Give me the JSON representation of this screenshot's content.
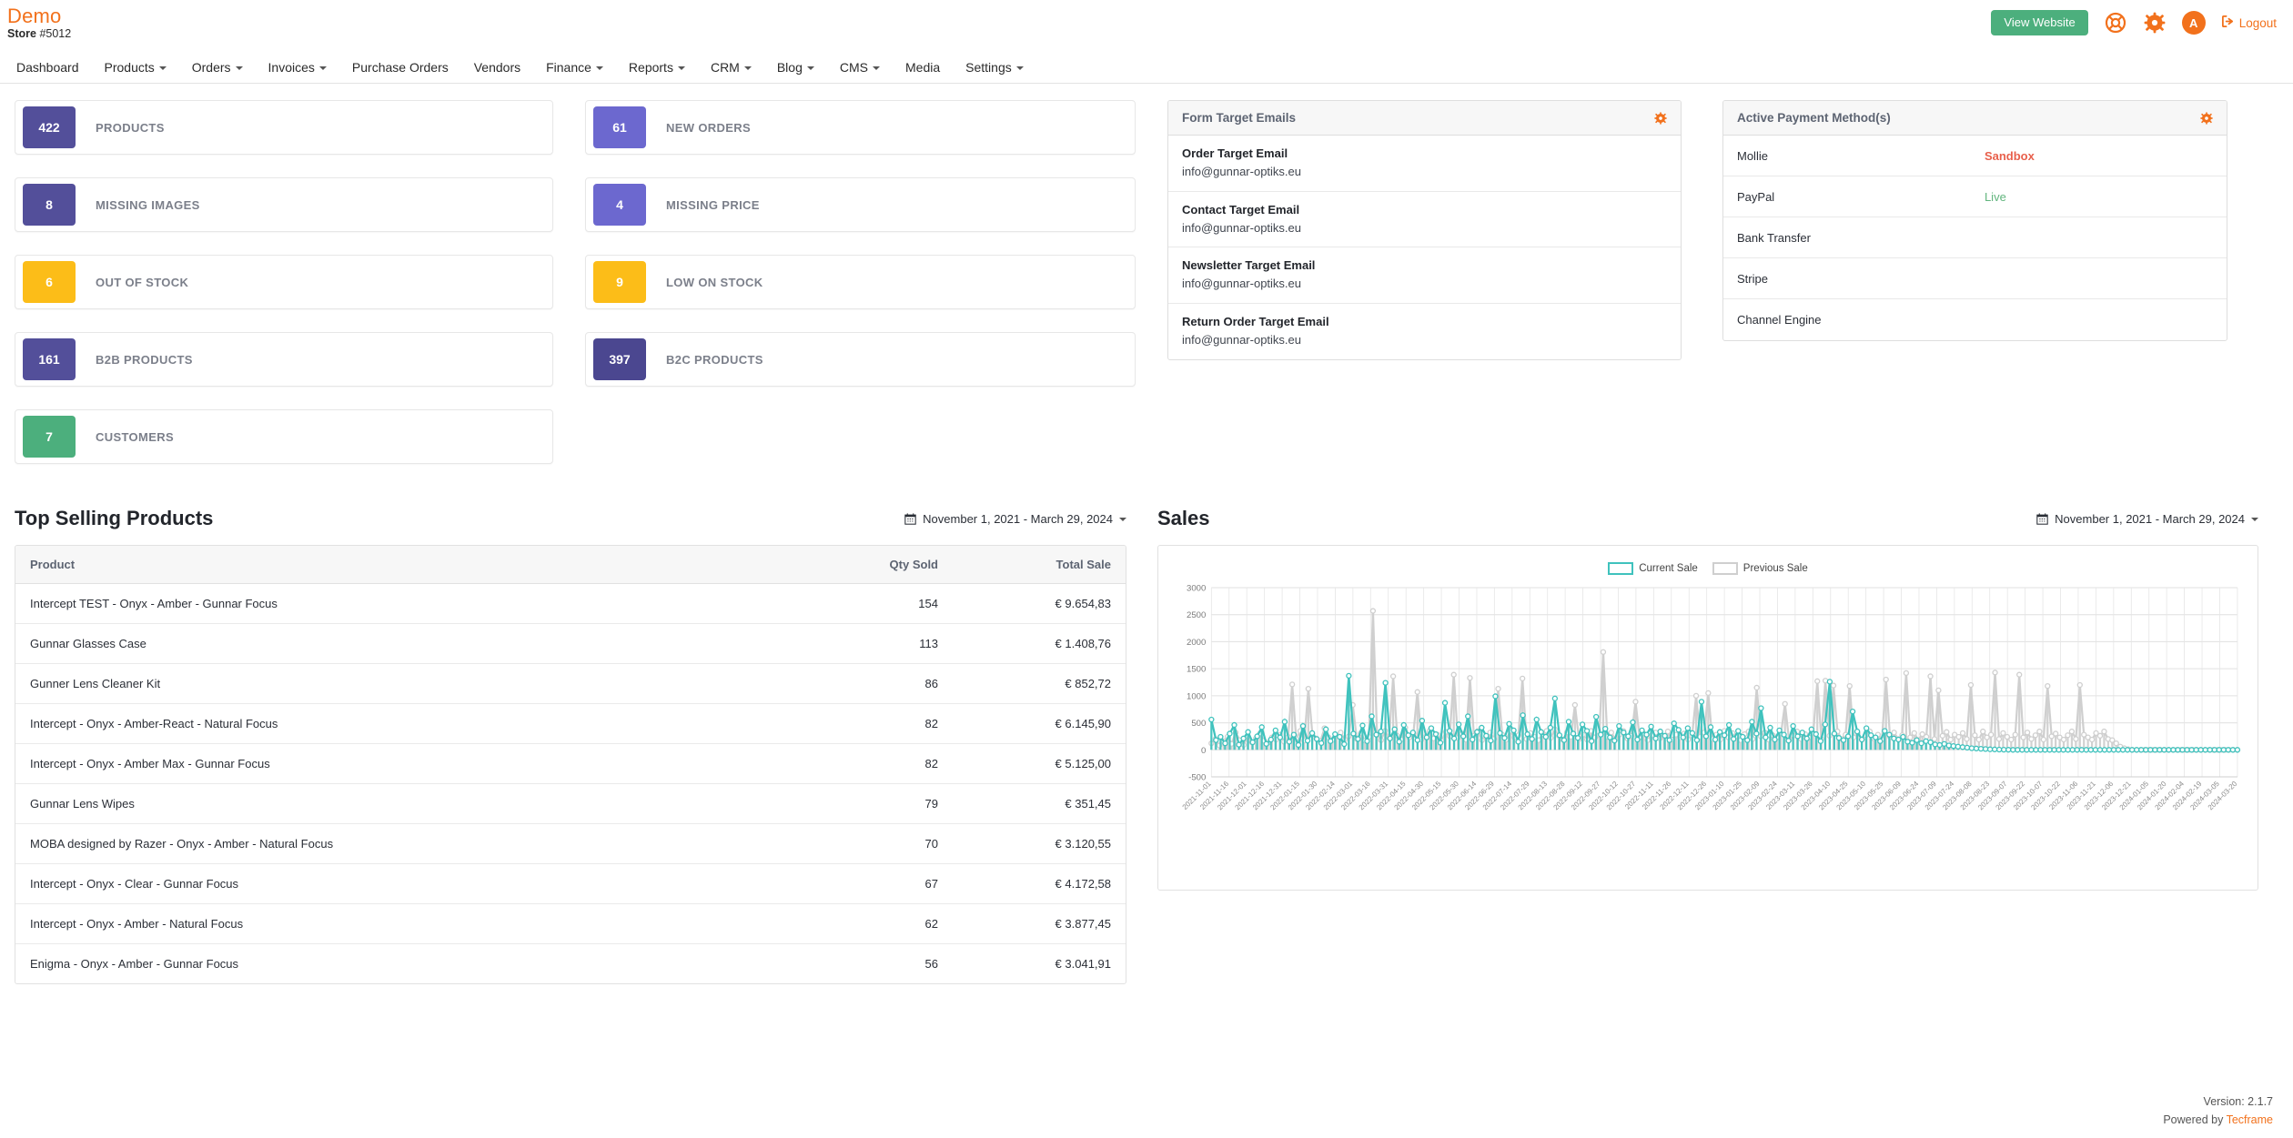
{
  "header": {
    "brand": "Demo",
    "store_label": "Store",
    "store_number": "#5012",
    "view_website_label": "View Website",
    "logout_label": "Logout",
    "avatar_initial": "A",
    "icons": [
      "lifebuoy-icon",
      "gear-icon",
      "avatar",
      "logout-icon"
    ],
    "accent_color": "#f2711c",
    "button_color": "#4caf7d"
  },
  "nav": {
    "items": [
      {
        "label": "Dashboard",
        "has_caret": false
      },
      {
        "label": "Products",
        "has_caret": true
      },
      {
        "label": "Orders",
        "has_caret": true
      },
      {
        "label": "Invoices",
        "has_caret": true
      },
      {
        "label": "Purchase Orders",
        "has_caret": false
      },
      {
        "label": "Vendors",
        "has_caret": false
      },
      {
        "label": "Finance",
        "has_caret": true
      },
      {
        "label": "Reports",
        "has_caret": true
      },
      {
        "label": "CRM",
        "has_caret": true
      },
      {
        "label": "Blog",
        "has_caret": true
      },
      {
        "label": "CMS",
        "has_caret": true
      },
      {
        "label": "Media",
        "has_caret": false
      },
      {
        "label": "Settings",
        "has_caret": true
      }
    ]
  },
  "stats_col_a": [
    {
      "value": "422",
      "label": "PRODUCTS",
      "color": "#534f9a"
    },
    {
      "value": "8",
      "label": "MISSING IMAGES",
      "color": "#534f9a"
    },
    {
      "value": "6",
      "label": "OUT OF STOCK",
      "color": "#fcbd18"
    },
    {
      "value": "161",
      "label": "B2B PRODUCTS",
      "color": "#534f9a"
    },
    {
      "value": "7",
      "label": "CUSTOMERS",
      "color": "#4caf7d"
    }
  ],
  "stats_col_b": [
    {
      "value": "61",
      "label": "NEW ORDERS",
      "color": "#6c68cf"
    },
    {
      "value": "4",
      "label": "MISSING PRICE",
      "color": "#6c68cf"
    },
    {
      "value": "9",
      "label": "LOW ON STOCK",
      "color": "#fcbd18"
    },
    {
      "value": "397",
      "label": "B2C PRODUCTS",
      "color": "#4b4790"
    }
  ],
  "form_emails_panel": {
    "title": "Form Target Emails",
    "gear_icon": "gear-icon",
    "rows": [
      {
        "label": "Order Target Email",
        "value": "info@gunnar-optiks.eu"
      },
      {
        "label": "Contact Target Email",
        "value": "info@gunnar-optiks.eu"
      },
      {
        "label": "Newsletter Target Email",
        "value": "info@gunnar-optiks.eu"
      },
      {
        "label": "Return Order Target Email",
        "value": "info@gunnar-optiks.eu"
      }
    ]
  },
  "payment_panel": {
    "title": "Active Payment Method(s)",
    "gear_icon": "gear-icon",
    "rows": [
      {
        "name": "Mollie",
        "status": "Sandbox",
        "status_type": "sandbox"
      },
      {
        "name": "PayPal",
        "status": "Live",
        "status_type": "live"
      },
      {
        "name": "Bank Transfer",
        "status": "",
        "status_type": "none"
      },
      {
        "name": "Stripe",
        "status": "",
        "status_type": "none"
      },
      {
        "name": "Channel Engine",
        "status": "",
        "status_type": "none"
      }
    ]
  },
  "top_selling": {
    "title": "Top Selling Products",
    "date_range": "November 1, 2021 - March 29, 2024",
    "columns": [
      "Product",
      "Qty Sold",
      "Total Sale"
    ],
    "rows": [
      {
        "product": "Intercept TEST - Onyx - Amber - Gunnar Focus",
        "qty": "154",
        "total": "€ 9.654,83"
      },
      {
        "product": "Gunnar Glasses Case",
        "qty": "113",
        "total": "€ 1.408,76"
      },
      {
        "product": "Gunner Lens Cleaner Kit",
        "qty": "86",
        "total": "€ 852,72"
      },
      {
        "product": "Intercept - Onyx - Amber-React - Natural Focus",
        "qty": "82",
        "total": "€ 6.145,90"
      },
      {
        "product": "Intercept - Onyx - Amber Max - Gunnar Focus",
        "qty": "82",
        "total": "€ 5.125,00"
      },
      {
        "product": "Gunnar Lens Wipes",
        "qty": "79",
        "total": "€ 351,45"
      },
      {
        "product": "MOBA designed by Razer - Onyx - Amber - Natural Focus",
        "qty": "70",
        "total": "€ 3.120,55"
      },
      {
        "product": "Intercept - Onyx - Clear - Gunnar Focus",
        "qty": "67",
        "total": "€ 4.172,58"
      },
      {
        "product": "Intercept - Onyx - Amber - Natural Focus",
        "qty": "62",
        "total": "€ 3.877,45"
      },
      {
        "product": "Enigma - Onyx - Amber - Gunnar Focus",
        "qty": "56",
        "total": "€ 3.041,91"
      }
    ]
  },
  "sales": {
    "title": "Sales",
    "date_range": "November 1, 2021 - March 29, 2024"
  },
  "footer": {
    "version": "Version: 2.1.7",
    "powered_prefix": "Powered by ",
    "powered_by": "Tecframe"
  },
  "chart_data": {
    "type": "line",
    "title": "Sales",
    "xlabel": "",
    "ylabel": "",
    "ylim": [
      -500,
      3000
    ],
    "yticks": [
      3000,
      2500,
      2000,
      1500,
      1000,
      500,
      0,
      -500
    ],
    "grid": true,
    "legend_position": "top-center",
    "date_range": "November 1, 2021 - March 29, 2024",
    "x_tick_labels": [
      "2021-11-01",
      "2021-11-16",
      "2021-12-01",
      "2021-12-16",
      "2021-12-31",
      "2022-01-15",
      "2022-01-30",
      "2022-02-14",
      "2022-03-01",
      "2022-03-16",
      "2022-03-31",
      "2022-04-15",
      "2022-04-30",
      "2022-05-15",
      "2022-05-30",
      "2022-06-14",
      "2022-06-29",
      "2022-07-14",
      "2022-07-29",
      "2022-08-13",
      "2022-08-28",
      "2022-09-12",
      "2022-09-27",
      "2022-10-12",
      "2022-10-27",
      "2022-11-11",
      "2022-11-26",
      "2022-12-11",
      "2022-12-26",
      "2023-01-10",
      "2023-01-25",
      "2023-02-09",
      "2023-02-24",
      "2023-03-11",
      "2023-03-26",
      "2023-04-10",
      "2023-04-25",
      "2023-05-10",
      "2023-05-25",
      "2023-06-09",
      "2023-06-24",
      "2023-07-09",
      "2023-07-24",
      "2023-08-08",
      "2023-08-23",
      "2023-09-07",
      "2023-09-22",
      "2023-10-07",
      "2023-10-22",
      "2023-11-06",
      "2023-11-21",
      "2023-12-06",
      "2023-12-21",
      "2024-01-05",
      "2024-01-20",
      "2024-02-04",
      "2024-02-19",
      "2024-03-05",
      "2024-03-20"
    ],
    "series": [
      {
        "name": "Current Sale",
        "color": "#3fc2bd",
        "note": "Dense daily spiky series, active Nov 2021 - mid 2022, then flat at 0",
        "values": [
          560,
          180,
          240,
          120,
          300,
          460,
          95,
          210,
          330,
          140,
          250,
          420,
          110,
          190,
          360,
          230,
          520,
          150,
          280,
          90,
          440,
          170,
          310,
          200,
          125,
          380,
          160,
          290,
          240,
          105,
          1370,
          300,
          200,
          450,
          160,
          620,
          280,
          340,
          1240,
          210,
          380,
          150,
          460,
          270,
          320,
          180,
          540,
          230,
          400,
          290,
          130,
          870,
          350,
          210,
          470,
          250,
          620,
          190,
          330,
          410,
          260,
          170,
          990,
          310,
          220,
          480,
          360,
          150,
          640,
          290,
          200,
          560,
          330,
          240,
          410,
          950,
          270,
          180,
          520,
          300,
          220,
          470,
          350,
          160,
          610,
          280,
          390,
          230,
          170,
          440,
          320,
          250,
          510,
          190,
          360,
          280,
          430,
          210,
          340,
          260,
          180,
          490,
          370,
          230,
          400,
          310,
          180,
          890,
          250,
          420,
          190,
          330,
          270,
          460,
          200,
          350,
          240,
          180,
          520,
          300,
          770,
          230,
          410,
          190,
          360,
          280,
          170,
          440,
          250,
          320,
          210,
          380,
          290,
          160,
          470,
          1260,
          300,
          220,
          180,
          250,
          710,
          340,
          190,
          400,
          270,
          230,
          160,
          350,
          280,
          210,
          190,
          240,
          150,
          130,
          180,
          120,
          160,
          140,
          100,
          90,
          110,
          80,
          70,
          60,
          50,
          40,
          30,
          25,
          20,
          15,
          10,
          8,
          5,
          3,
          2,
          0,
          0,
          0,
          0,
          0,
          0,
          0,
          0,
          0,
          0,
          0,
          0,
          0,
          0,
          0,
          0,
          0,
          0,
          0,
          0,
          0,
          0,
          0,
          0,
          0,
          0,
          0,
          0,
          0,
          0,
          0,
          0,
          0,
          0,
          0,
          0,
          0,
          0,
          0,
          0,
          0,
          0,
          0,
          0,
          0,
          0,
          0,
          0,
          0,
          0
        ]
      },
      {
        "name": "Previous Sale",
        "color": "#cfcfcf",
        "note": "Dense daily spiky series with larger peaks, flat at 0 after late 2023",
        "values": [
          120,
          200,
          80,
          160,
          240,
          110,
          320,
          180,
          90,
          260,
          140,
          210,
          300,
          170,
          130,
          230,
          190,
          280,
          150,
          240,
          1210,
          200,
          350,
          170,
          1130,
          290,
          210,
          160,
          400,
          230,
          180,
          270,
          320,
          190,
          250,
          830,
          200,
          310,
          170,
          240,
          2570,
          290,
          180,
          350,
          220,
          1360,
          260,
          190,
          410,
          230,
          300,
          1070,
          190,
          240,
          350,
          210,
          280,
          170,
          330,
          250,
          1390,
          220,
          300,
          190,
          1330,
          260,
          350,
          180,
          240,
          320,
          200,
          1130,
          280,
          190,
          350,
          230,
          270,
          1320,
          200,
          310,
          240,
          180,
          290,
          350,
          220,
          380,
          260,
          190,
          320,
          240,
          830,
          200,
          280,
          190,
          350,
          230,
          270,
          1810,
          240,
          320,
          190,
          280,
          350,
          210,
          260,
          890,
          230,
          300,
          180,
          270,
          320,
          210,
          250,
          340,
          190,
          280,
          230,
          300,
          190,
          260,
          1000,
          240,
          320,
          1050,
          200,
          280,
          190,
          350,
          230,
          310,
          260,
          180,
          290,
          340,
          200,
          1150,
          250,
          320,
          190,
          270,
          230,
          300,
          850,
          180,
          260,
          340,
          200,
          290,
          230,
          310,
          1270,
          200,
          1280,
          260,
          1190,
          340,
          200,
          280,
          1180,
          230,
          310,
          190,
          270,
          340,
          210,
          280,
          190,
          1300,
          240,
          320,
          200,
          270,
          1420,
          230,
          310,
          180,
          290,
          240,
          1360,
          200,
          1100,
          260,
          330,
          190,
          280,
          240,
          310,
          200,
          1200,
          270,
          190,
          340,
          230,
          280,
          1430,
          200,
          310,
          240,
          190,
          280,
          1390,
          230,
          320,
          200,
          270,
          340,
          190,
          1180,
          250,
          300,
          230,
          190,
          270,
          340,
          200,
          1200,
          280,
          230,
          190,
          310,
          260,
          340,
          200,
          180,
          120,
          60,
          30,
          10,
          0,
          0,
          0,
          0,
          0,
          0,
          0,
          0,
          0,
          0,
          0,
          0,
          0,
          0,
          0,
          0,
          0,
          0,
          0,
          0,
          0,
          0,
          0,
          0,
          0,
          0,
          0
        ]
      }
    ]
  }
}
